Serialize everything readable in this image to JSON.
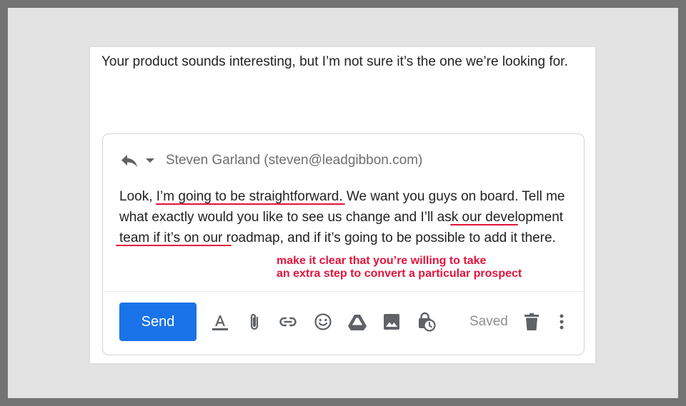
{
  "email": {
    "received_text": "Your product sounds interesting, but I’m not sure it’s the one we’re looking for."
  },
  "reply": {
    "recipient": "Steven Garland (steven@leadgibbon.com)",
    "body": {
      "p1": "Look, ",
      "h1": "I’m going to be straightforward",
      "p2": ". We want you guys on board. Tell me what exactly would you like to see us change and ",
      "h2a": "I’ll ask our",
      "h2b": "development team",
      "p3": " if it’s on our roadmap, and if it’s going to be possible to add it there."
    },
    "annotation": {
      "line1": "make it clear that you’re willing to take",
      "line2": "an extra step to convert a particular prospect"
    },
    "toolbar": {
      "send_label": "Send",
      "saved_label": "Saved",
      "icons": [
        "format-text-icon",
        "attachment-icon",
        "link-icon",
        "emoji-icon",
        "drive-icon",
        "photo-icon",
        "confidential-mode-icon",
        "delete-icon",
        "more-options-icon"
      ]
    }
  },
  "colors": {
    "accent": "#1a73e8",
    "annotation": "#e5133b",
    "frame": "#737373",
    "background": "#e3e3e3"
  }
}
